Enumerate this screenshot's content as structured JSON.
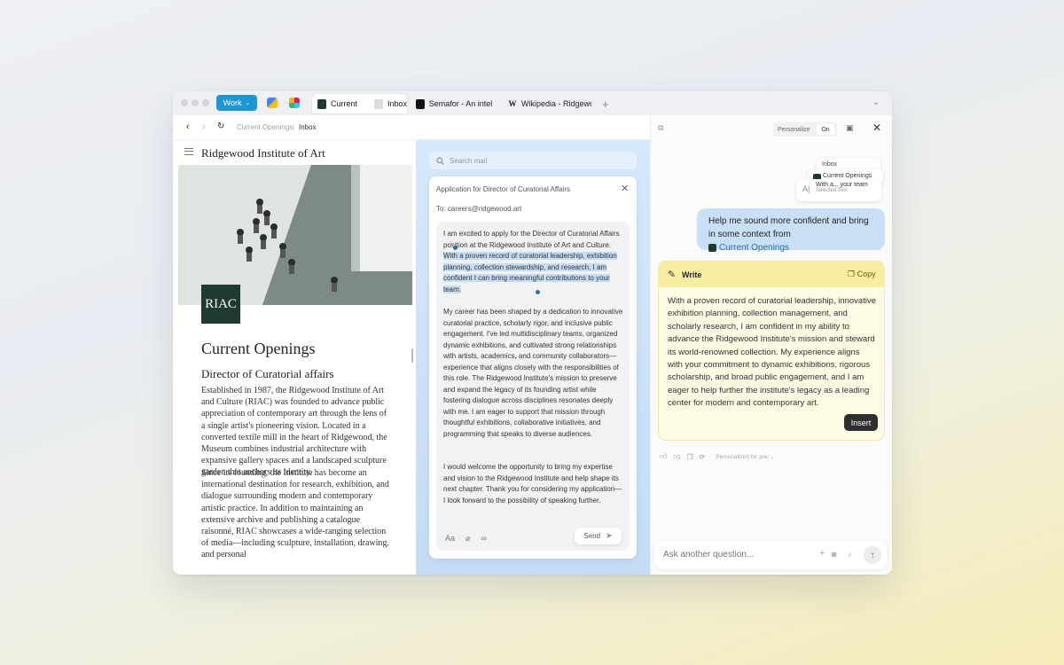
{
  "tabbar": {
    "space_label": "Work",
    "tabs": [
      {
        "label": "Current",
        "fav": "RIAC"
      },
      {
        "label": "Inbox"
      },
      {
        "label": "Semafor - An intellig"
      },
      {
        "label": "Wikipedia - Ridgewoo"
      }
    ],
    "new_tab": "+",
    "menu": "⌄"
  },
  "nav": {
    "crumb_parent": "Current Openings",
    "crumb_current": "Inbox"
  },
  "site": {
    "title": "Ridgewood Institute of Art",
    "logo": "RIAC",
    "heading": "Current Openings",
    "subheading": "Director of Curatorial affairs",
    "para1": "Established in 1987, the Ridgewood Institute of Art and Culture (RIAC) was founded to advance public appreciation of contemporary art through the lens of a single artist's pioneering vision. Located in a converted textile mill in the heart of Ridgewood, the Museum combines industrial architecture with expansive gallery spaces and a landscaped sculpture garden that anchors its identity.",
    "para2": "Since its founding, the Institute has become an international destination for research, exhibition, and dialogue surrounding modern and contemporary artistic practice. In addition to maintaining an extensive archive and publishing a catalogue raisonné, RIAC showcases a wide-ranging selection of media—including sculpture, installation, drawing, and personal"
  },
  "mail": {
    "search_placeholder": "Search mail",
    "subject": "Application for Director of Curatorial Affairs",
    "to": "To: careers@ridgewood.art",
    "p1_plain": "I am excited to apply for the Director of Curatorial Affairs position at the Ridgewood Institute of Art and Culture.",
    "p1_selected": "With a proven record of curatorial leadership, exhibition planning, collection stewardship, and research, I am confident I can bring meaningful contributions to your team.",
    "p2": "My career has been shaped by a dedication to innovative curatorial practice, scholarly rigor, and inclusive public engagement. I've led multidisciplinary teams, organized dynamic exhibitions, and cultivated strong relationships with artists, academics, and community collaborators—experience that aligns closely with the responsibilities of this role. The Ridgewood Institute's mission to preserve and expand the legacy of its founding artist while fostering dialogue across disciplines resonates deeply with me. I am eager to support that mission through thoughtful exhibitions, collaborative initiatives, and programming that speaks to diverse audiences.",
    "p3": "I would welcome the opportunity to bring my expertise and vision to the Ridgewood Institute and help shape its next chapter. Thank you for considering my application—I look forward to the possibility of speaking further.",
    "font_tool": "Aa",
    "send_label": "Send"
  },
  "assistant": {
    "personalize_label": "Personalize",
    "personalize_state": "On",
    "context_cards": [
      {
        "label": "Inbox"
      },
      {
        "label": "Current Openings"
      },
      {
        "label": "With a... your team",
        "sub": "Selected Text"
      }
    ],
    "user_message": "Help me sound more confident and bring in some context from",
    "user_context": "Current Openings",
    "write_label": "Write",
    "copy_label": "Copy",
    "response": "With a proven record of curatorial leadership, innovative exhibition planning, collection management, and scholarly research, I am confident in my ability to advance the Ridgewood Institute's mission and steward its world-renowned collection. My experience aligns with your commitment to dynamic exhibitions, rigorous scholarship, and broad public engagement, and I am eager to help further the institute's legacy as a leading center for modern and contemporary art.",
    "insert_label": "Insert",
    "personalized_note": "Personalized for you",
    "ask_placeholder": "Ask another question..."
  },
  "colors": {
    "space": "#1e95d4",
    "user_bubble": "#c8dff5",
    "write_header": "#f8ee9f",
    "selection": "#c5dcf3"
  }
}
